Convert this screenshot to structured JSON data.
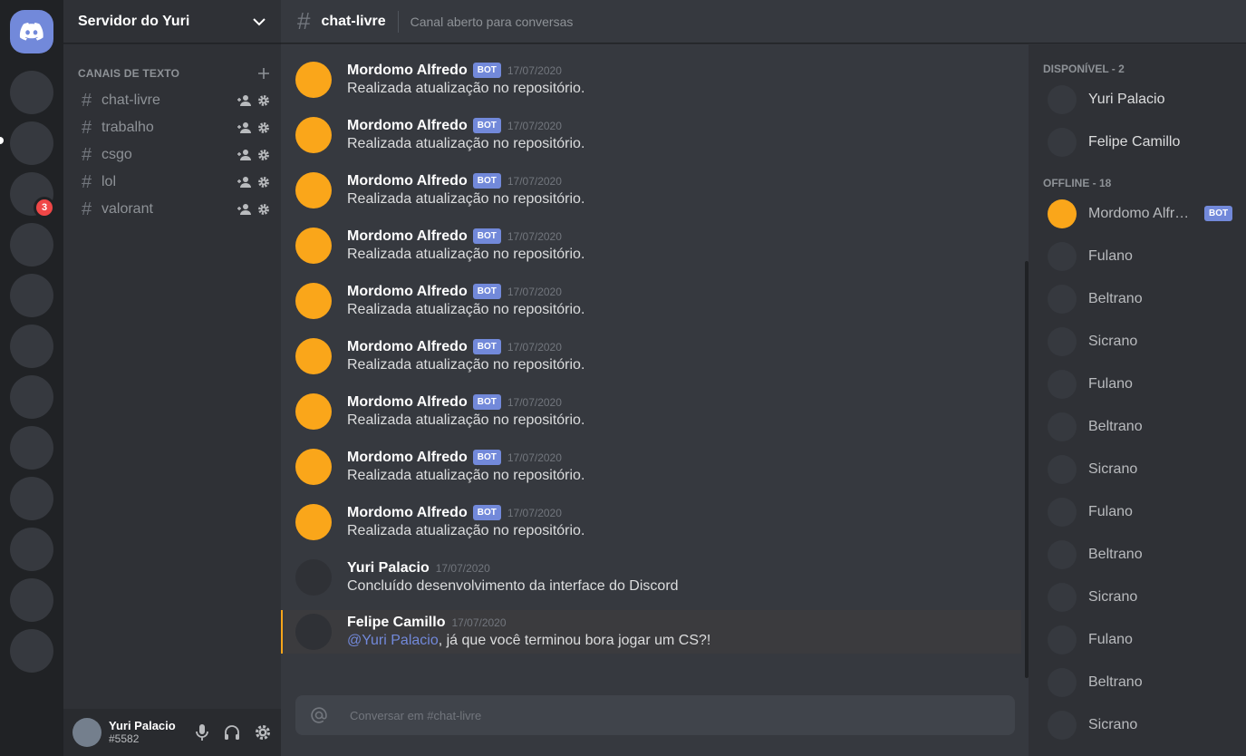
{
  "server": {
    "name": "Servidor do Yuri",
    "badge": "3",
    "server_count": 12
  },
  "channels": {
    "category": "CANAIS DE TEXTO",
    "list": [
      {
        "name": "chat-livre"
      },
      {
        "name": "trabalho"
      },
      {
        "name": "csgo"
      },
      {
        "name": "lol"
      },
      {
        "name": "valorant"
      }
    ]
  },
  "user": {
    "name": "Yuri Palacio",
    "tag": "#5582"
  },
  "topbar": {
    "channel": "chat-livre",
    "topic": "Canal aberto para conversas"
  },
  "messages": [
    {
      "author": "Mordomo Alfredo",
      "bot": true,
      "timestamp": "17/07/2020",
      "text": "Realizada atualização no repositório.",
      "avatar_color": "#faa61a"
    },
    {
      "author": "Mordomo Alfredo",
      "bot": true,
      "timestamp": "17/07/2020",
      "text": "Realizada atualização no repositório.",
      "avatar_color": "#faa61a"
    },
    {
      "author": "Mordomo Alfredo",
      "bot": true,
      "timestamp": "17/07/2020",
      "text": "Realizada atualização no repositório.",
      "avatar_color": "#faa61a"
    },
    {
      "author": "Mordomo Alfredo",
      "bot": true,
      "timestamp": "17/07/2020",
      "text": "Realizada atualização no repositório.",
      "avatar_color": "#faa61a"
    },
    {
      "author": "Mordomo Alfredo",
      "bot": true,
      "timestamp": "17/07/2020",
      "text": "Realizada atualização no repositório.",
      "avatar_color": "#faa61a"
    },
    {
      "author": "Mordomo Alfredo",
      "bot": true,
      "timestamp": "17/07/2020",
      "text": "Realizada atualização no repositório.",
      "avatar_color": "#faa61a"
    },
    {
      "author": "Mordomo Alfredo",
      "bot": true,
      "timestamp": "17/07/2020",
      "text": "Realizada atualização no repositório.",
      "avatar_color": "#faa61a"
    },
    {
      "author": "Mordomo Alfredo",
      "bot": true,
      "timestamp": "17/07/2020",
      "text": "Realizada atualização no repositório.",
      "avatar_color": "#faa61a"
    },
    {
      "author": "Mordomo Alfredo",
      "bot": true,
      "timestamp": "17/07/2020",
      "text": "Realizada atualização no repositório.",
      "avatar_color": "#faa61a"
    },
    {
      "author": "Mordomo Alfredo",
      "bot": true,
      "timestamp": "17/07/2020",
      "text": "Realizada atualização no repositório.",
      "avatar_color": "#faa61a"
    },
    {
      "author": "Yuri Palacio",
      "bot": false,
      "timestamp": "17/07/2020",
      "text": "Concluído desenvolvimento da interface do Discord",
      "avatar_color": "#2f3136"
    },
    {
      "author": "Felipe Camillo",
      "bot": false,
      "timestamp": "17/07/2020",
      "mention": "@Yuri Palacio",
      "text": ", já que você terminou bora jogar um CS?!",
      "avatar_color": "#2f3136",
      "highlight": true
    }
  ],
  "bot_label": "BOT",
  "composer": {
    "placeholder": "Conversar em #chat-livre"
  },
  "members": {
    "online_title": "DISPONÍVEL - 2",
    "online": [
      {
        "name": "Yuri Palacio"
      },
      {
        "name": "Felipe Camillo"
      }
    ],
    "offline_title": "OFFLINE - 18",
    "offline": [
      {
        "name": "Mordomo Alfredo",
        "bot": true
      },
      {
        "name": "Fulano"
      },
      {
        "name": "Beltrano"
      },
      {
        "name": "Sicrano"
      },
      {
        "name": "Fulano"
      },
      {
        "name": "Beltrano"
      },
      {
        "name": "Sicrano"
      },
      {
        "name": "Fulano"
      },
      {
        "name": "Beltrano"
      },
      {
        "name": "Sicrano"
      },
      {
        "name": "Fulano"
      },
      {
        "name": "Beltrano"
      },
      {
        "name": "Sicrano"
      }
    ]
  },
  "colors": {
    "accent": "#7289da",
    "bot_avatar": "#faa61a",
    "mention_border": "#faa61a",
    "badge": "#f04747"
  }
}
